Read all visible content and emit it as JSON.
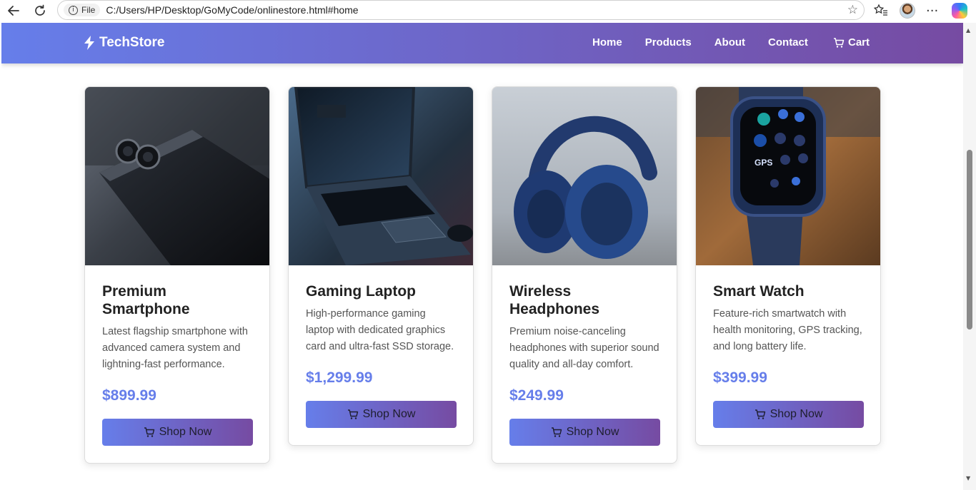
{
  "browser": {
    "site_info_label": "File",
    "url": "C:/Users/HP/Desktop/GoMyCode/onlinestore.html#home",
    "back_icon": "arrow-left-icon",
    "reload_icon": "reload-icon",
    "favorite_icon": "star-icon",
    "favorites_bar_icon": "favorites-icon",
    "profile_icon": "avatar",
    "menu_icon": "more-icon",
    "copilot_icon": "copilot-icon"
  },
  "header": {
    "brand": "TechStore",
    "brand_icon": "bolt-icon",
    "nav": [
      "Home",
      "Products",
      "About",
      "Contact"
    ],
    "cart_label": "Cart",
    "cart_icon": "cart-icon"
  },
  "colors": {
    "gradient_start": "#667eea",
    "gradient_end": "#764ba2",
    "price": "#667eea"
  },
  "products": [
    {
      "title": "Premium Smartphone",
      "description": "Latest flagship smartphone with advanced camera system and lightning-fast performance.",
      "price": "$899.99",
      "button_label": "Shop Now",
      "image": "smartphone-image"
    },
    {
      "title": "Gaming Laptop",
      "description": "High-performance gaming laptop with dedicated graphics card and ultra-fast SSD storage.",
      "price": "$1,299.99",
      "button_label": "Shop Now",
      "image": "laptop-image"
    },
    {
      "title": "Wireless Headphones",
      "description": "Premium noise-canceling headphones with superior sound quality and all-day comfort.",
      "price": "$249.99",
      "button_label": "Shop Now",
      "image": "headphones-image"
    },
    {
      "title": "Smart Watch",
      "description": "Feature-rich smartwatch with health monitoring, GPS tracking, and long battery life.",
      "price": "$399.99",
      "button_label": "Shop Now",
      "image": "smartwatch-image"
    }
  ]
}
